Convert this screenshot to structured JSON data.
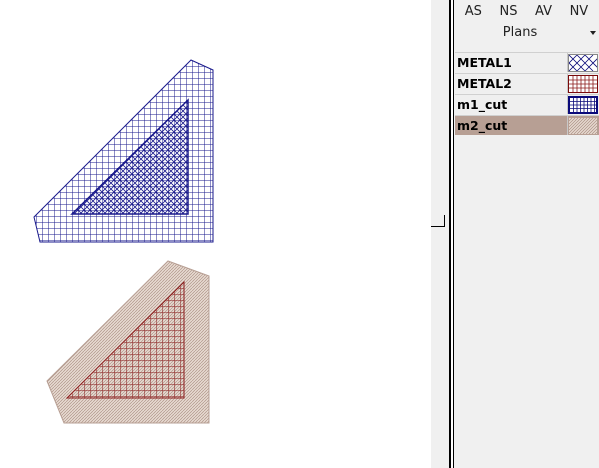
{
  "tabs": [
    "AS",
    "NS",
    "AV",
    "NV"
  ],
  "plans": {
    "label": "Plans"
  },
  "layers": [
    {
      "name": "METAL1",
      "color": "#0a0a7a",
      "pattern": "cross-diagonal",
      "selected": false
    },
    {
      "name": "METAL2",
      "color": "#7a0a0a",
      "pattern": "grid",
      "selected": false
    },
    {
      "name": "m1_cut",
      "color": "#0a0a7a",
      "pattern": "grid-bold-border",
      "selected": false
    },
    {
      "name": "m2_cut",
      "color": "#b79f94",
      "pattern": "fine-diagonal",
      "selected": true
    }
  ],
  "colors": {
    "metal1": "#1a1a8c",
    "metal2": "#8a1a1a",
    "m2_fill": "#d9c7bd",
    "selected_row": "#b79f94"
  }
}
